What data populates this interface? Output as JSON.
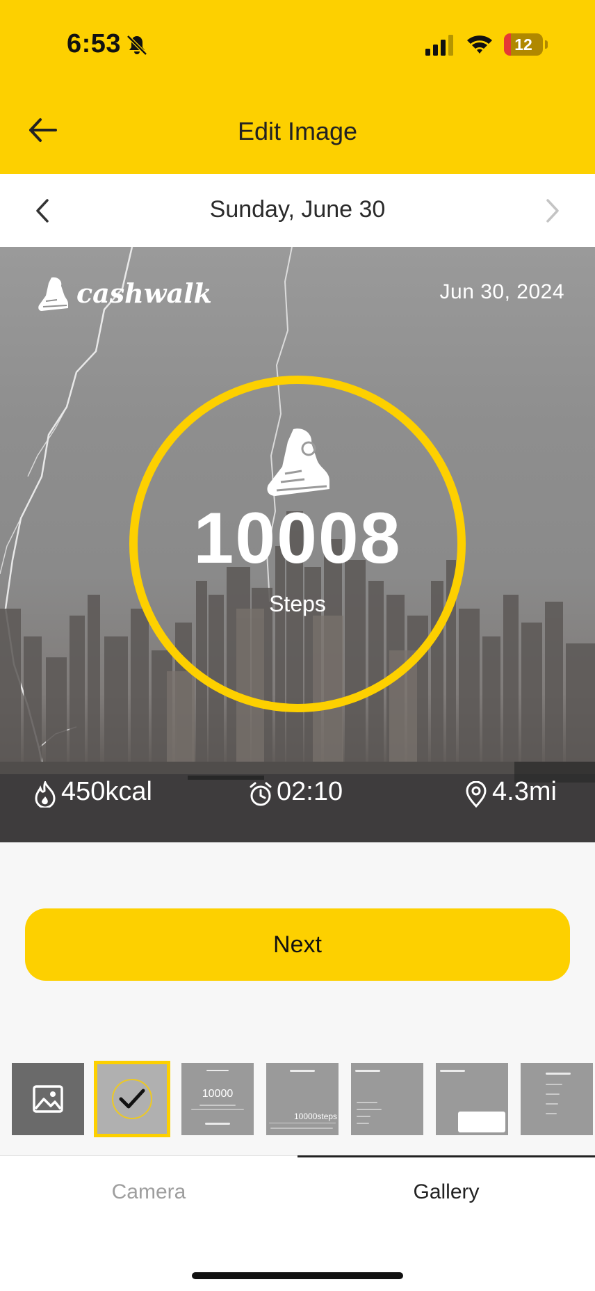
{
  "status_bar": {
    "time": "6:53",
    "battery": "12"
  },
  "header": {
    "title": "Edit Image"
  },
  "date_nav": {
    "label": "Sunday, June 30"
  },
  "photo_card": {
    "brand": "cashwalk",
    "date": "Jun 30, 2024",
    "steps_value": "10008",
    "steps_label": "Steps",
    "calories": "450kcal",
    "duration": "02:10",
    "distance": "4.3mi"
  },
  "actions": {
    "next_label": "Next"
  },
  "thumbnails": {
    "t3_value": "10000",
    "t4_value": "10000steps"
  },
  "tabs": {
    "camera": "Camera",
    "gallery": "Gallery",
    "active": "Gallery"
  },
  "colors": {
    "accent": "#FDD000",
    "text": "#222222",
    "inactive_tab": "#9E9E9E"
  }
}
